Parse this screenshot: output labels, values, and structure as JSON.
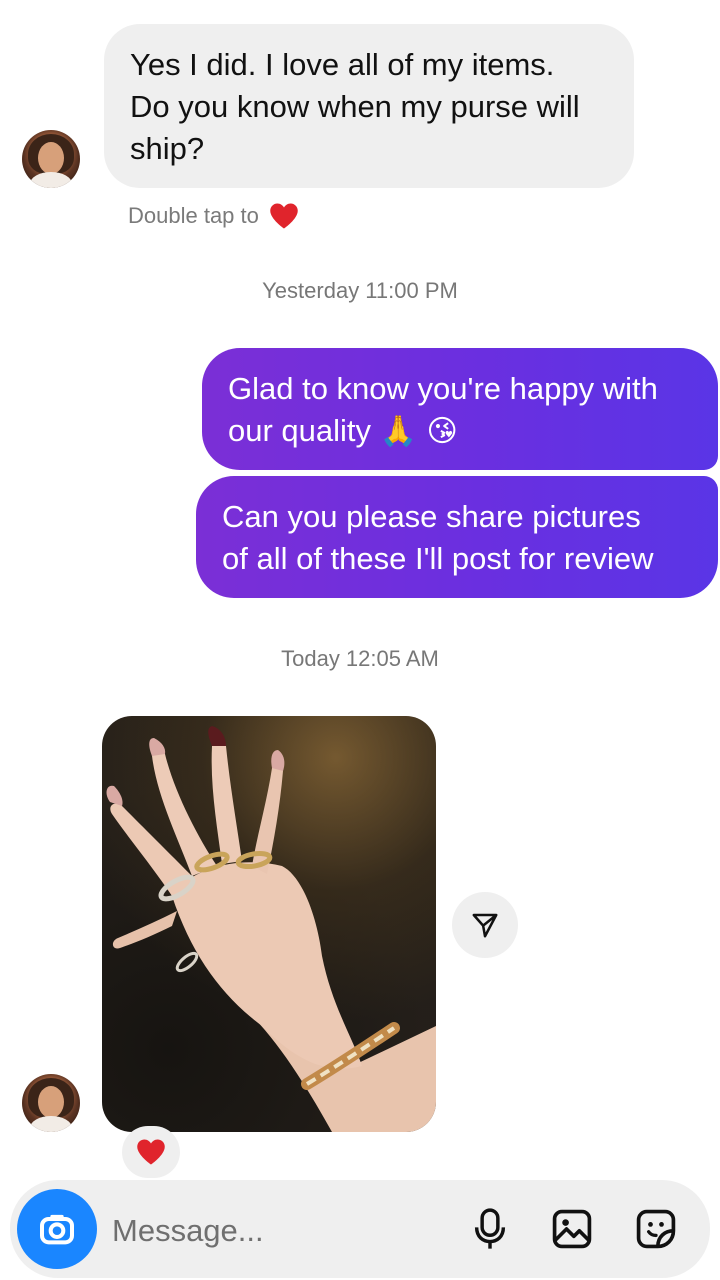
{
  "messages": {
    "incoming_1": {
      "line1": "Yes I did.  I love all of my items.",
      "line2": "Do you know when my purse will",
      "line3": "ship?"
    },
    "double_tap": "Double tap to",
    "timestamp_1": "Yesterday 11:00 PM",
    "outgoing_1": {
      "line1": "Glad to know you're happy with",
      "line2": "our quality",
      "emoji": "🙏 😘"
    },
    "outgoing_2": {
      "line1": "Can you please share pictures",
      "line2": "of all of these I'll post for review"
    },
    "timestamp_2": "Today 12:05 AM",
    "photo_reaction": "❤"
  },
  "composer": {
    "placeholder": "Message..."
  },
  "colors": {
    "outgoing_gradient_start": "#7b2fd6",
    "outgoing_gradient_end": "#5a35e6",
    "incoming_bubble": "#efefef",
    "camera_button": "#1a86ff",
    "heart": "#e0242c"
  },
  "icons": {
    "share": "paper-plane-icon",
    "camera": "camera-icon",
    "mic": "microphone-icon",
    "gallery": "image-icon",
    "sticker": "sticker-icon",
    "heart": "heart-icon"
  }
}
